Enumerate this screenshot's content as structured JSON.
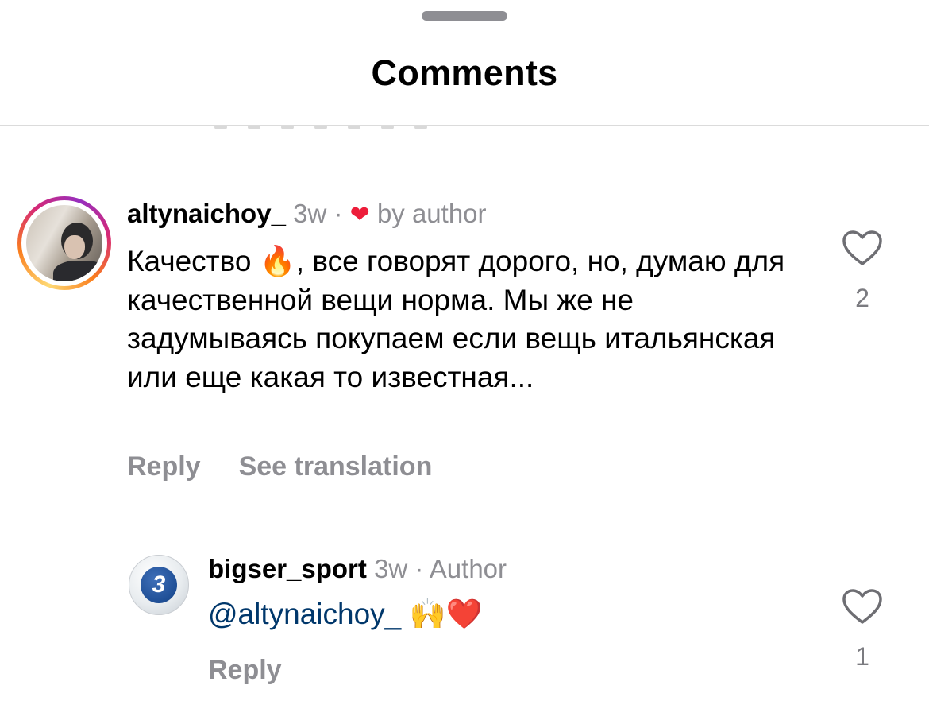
{
  "sheet": {
    "title": "Comments"
  },
  "comments": [
    {
      "username": "altynaichoy_",
      "age": "3w",
      "dot": "·",
      "author_heart": "❤",
      "author_liked_label": "by author",
      "text_part1": "Качество ",
      "text_emoji": "🔥",
      "text_part2": ", все говорят дорого, но, думаю для качественной вещи норма. Мы же не задумываясь покупаем если вещь итальянская или еще какая то известная...",
      "reply_label": "Reply",
      "translation_label": "See translation",
      "like_icon": "heart-outline-icon",
      "like_count": "2"
    },
    {
      "username": "bigser_sport",
      "age": "3w",
      "dot": "·",
      "badge": "Author",
      "avatar_letter": "3",
      "mention": "@altynaichoy_",
      "emojis": "🙌❤️",
      "reply_label": "Reply",
      "like_icon": "heart-outline-icon",
      "like_count": "1"
    }
  ],
  "colors": {
    "muted": "#8e8e93",
    "mention": "#00376b",
    "heart_red": "#ed1d3a",
    "divider": "#dbdbdb"
  }
}
